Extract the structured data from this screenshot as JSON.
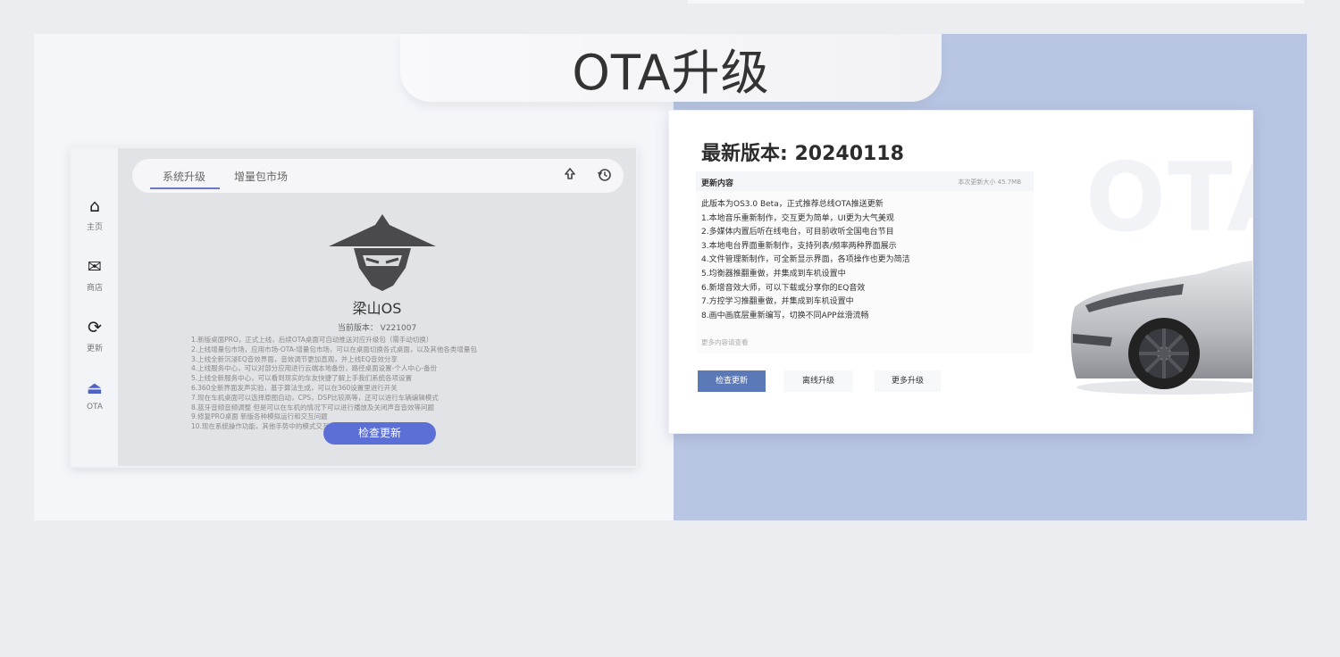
{
  "page": {
    "title": "OTA升级"
  },
  "device": {
    "sidebar": [
      {
        "icon": "home-icon",
        "glyph": "⌂",
        "label": "主页"
      },
      {
        "icon": "mail-icon",
        "glyph": "✉",
        "label": "商店"
      },
      {
        "icon": "refresh-icon",
        "glyph": "⟳",
        "label": "更新"
      },
      {
        "icon": "upgrade-icon",
        "glyph": "⏏",
        "label": "OTA"
      }
    ],
    "tabs": [
      "系统升级",
      "增量包市场"
    ],
    "os_name": "梁山OS",
    "version": "当前版本： V221007",
    "notes": [
      "1.新版桌面PRO，正式上线，后续OTA桌面可自动推送对应升级包（需手动切换）",
      "2.上线增量包市场，应用市场-OTA-增量包市场，可以在桌面切换各式桌面，以及其他各类增量包",
      "3.上线全新沉浸EQ音效界面，音效调节更加直观，并上线EQ音效分享",
      "4.上线服务中心，可以对部分应用进行云端本地备份，路径桌面设置-个人中心-备份",
      "5.上线全新服务中心，可以看到现实的车友快捷了解上手我们系统各项设置",
      "6.360全新界面发声实验，基于算法生成，可以在360设置里进行开关",
      "7.现在车机桌面可以选择原图自动，CPS，DSP比较高等，还可以进行车辆编辑模式",
      "8.蓝牙音频音频调整 但是可以在车机的情况下可以进行播放及关闭声音音效等问题",
      "9.修复PRO桌面 新版各种模拟运行和交互问题",
      "10.现在系统操作功能，其他手势中的模式交互安卓点击事件"
    ],
    "check_button": "检查更新"
  },
  "card": {
    "watermark": "OTA",
    "latest_label": "最新版本: 20240118",
    "content_title": "更新内容",
    "size_text": "本次更新大小 45.7MB",
    "notes": [
      "此版本为OS3.0 Beta，正式推荐总线OTA推送更新",
      "1.本地音乐重新制作，交互更为简单，UI更为大气美观",
      "2.多媒体内置后听在线电台，可目前收听全国电台节目",
      "3.本地电台界面重新制作，支持列表/频率两种界面展示",
      "4.文件管理新制作，可全新显示界面，各项操作也更为简洁",
      "5.均衡器推翻重做，并集成到车机设置中",
      "6.新增音效大师，可以下载或分享你的EQ音效",
      "7.方控学习推翻重做，并集成到车机设置中",
      "8.画中画底层重新编写，切换不同APP丝滑流畅"
    ],
    "more_text": "更多内容请查看",
    "buttons": [
      "检查更新",
      "离线升级",
      "更多升级"
    ]
  }
}
